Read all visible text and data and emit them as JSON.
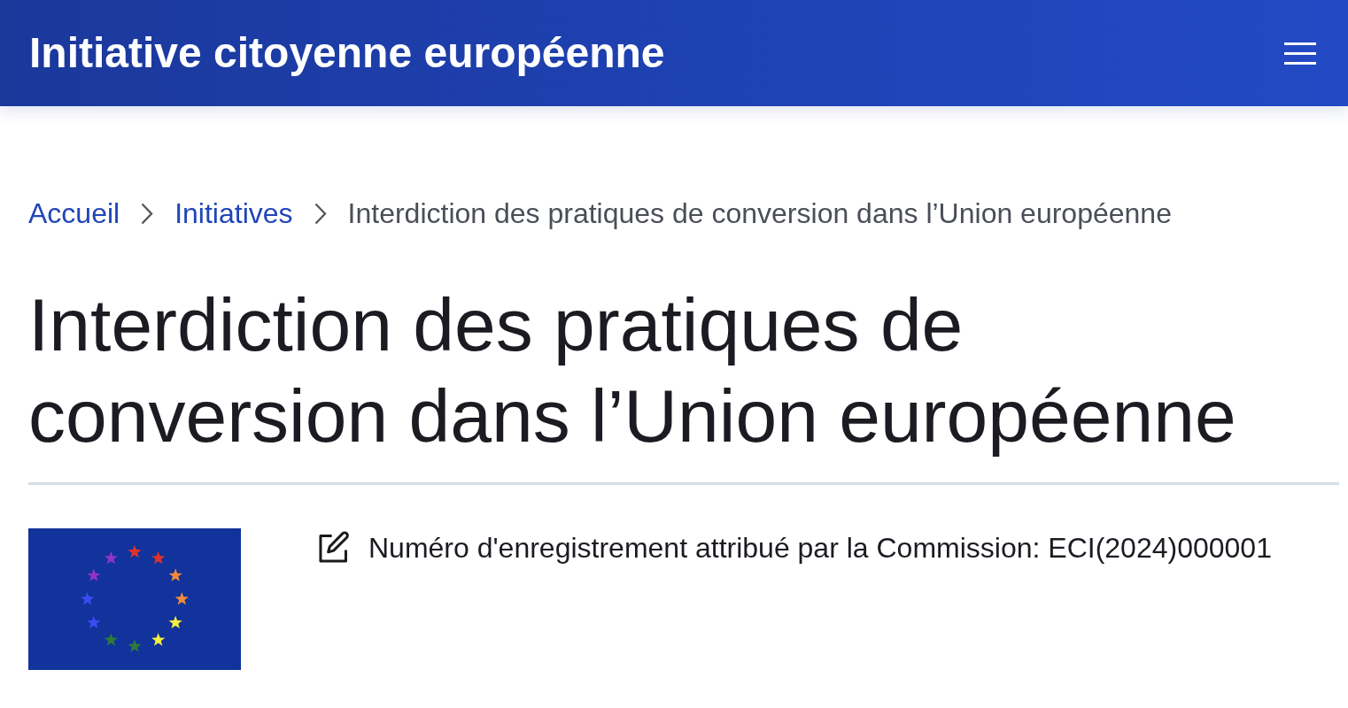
{
  "header": {
    "title": "Initiative citoyenne européenne"
  },
  "breadcrumb": [
    {
      "label": "Accueil",
      "kind": "link"
    },
    {
      "label": "Initiatives",
      "kind": "link"
    },
    {
      "label": "Interdiction des pratiques de conversion dans l’Union européenne",
      "kind": "current"
    }
  ],
  "page_title": "Interdiction des pratiques de conversion dans l’Union européenne",
  "registration": {
    "text": "Numéro d'enregistrement attribué par la Commission: ECI(2024)000001"
  }
}
